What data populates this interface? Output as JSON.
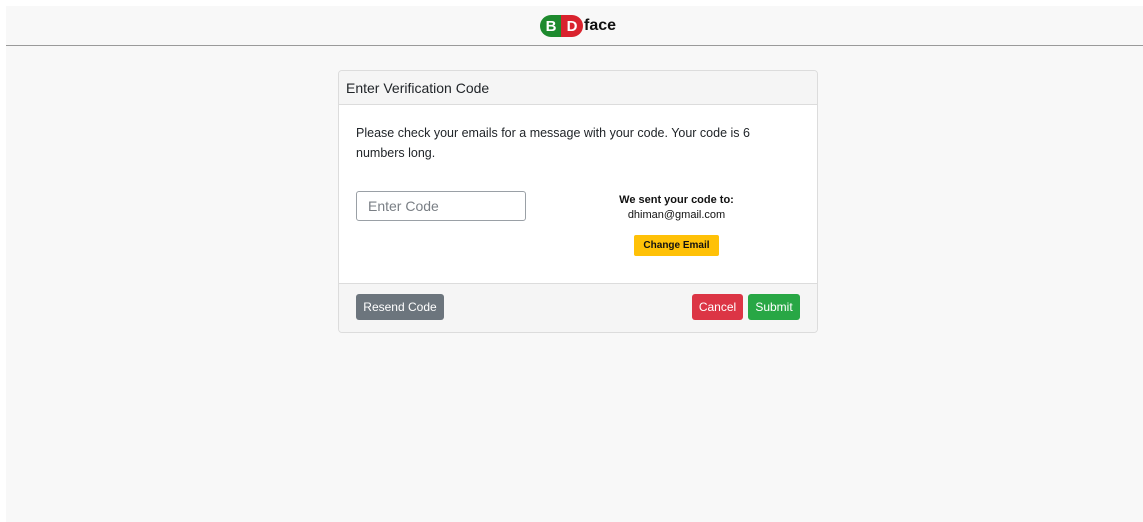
{
  "brand": {
    "letter_b": "B",
    "letter_d": "D",
    "name": "face",
    "colors": {
      "b": "#1e8a2e",
      "d": "#d9232e"
    }
  },
  "card": {
    "title": "Enter Verification Code",
    "instructions": "Please check your emails for a message with your code. Your code is 6 numbers long.",
    "code_input": {
      "placeholder": "Enter Code",
      "value": ""
    },
    "sent_label": "We sent your code to:",
    "sent_email": "dhiman@gmail.com",
    "change_email_label": "Change Email"
  },
  "footer": {
    "resend_label": "Resend Code",
    "cancel_label": "Cancel",
    "submit_label": "Submit"
  },
  "colors": {
    "warning": "#ffc107",
    "secondary": "#6c757d",
    "danger": "#dc3545",
    "success": "#28a745"
  }
}
